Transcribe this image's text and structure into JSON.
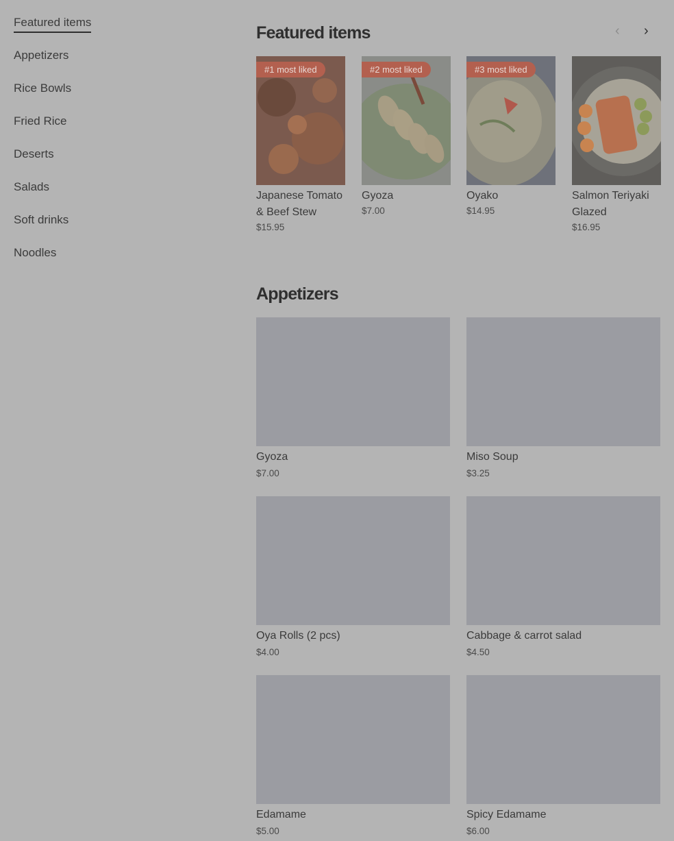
{
  "sidebar": {
    "items": [
      {
        "label": "Featured items",
        "active": true
      },
      {
        "label": "Appetizers"
      },
      {
        "label": "Rice Bowls"
      },
      {
        "label": "Fried Rice"
      },
      {
        "label": "Deserts"
      },
      {
        "label": "Salads"
      },
      {
        "label": "Soft drinks"
      },
      {
        "label": "Noodles"
      }
    ]
  },
  "featured": {
    "title": "Featured items",
    "prev_icon": "chevron-left-icon",
    "next_icon": "chevron-right-icon",
    "items": [
      {
        "badge": "#1 most liked",
        "name": "Japanese Tomato & Beef Stew",
        "price": "$15.95"
      },
      {
        "badge": "#2 most liked",
        "name": "Gyoza",
        "price": "$7.00"
      },
      {
        "badge": "#3 most liked",
        "name": "Oyako",
        "price": "$14.95"
      },
      {
        "badge": "",
        "name": "Salmon Teriyaki Glazed",
        "price": "$16.95"
      }
    ]
  },
  "appetizers": {
    "title": "Appetizers",
    "items": [
      {
        "name": "Gyoza",
        "price": "$7.00"
      },
      {
        "name": "Miso Soup",
        "price": "$3.25"
      },
      {
        "name": "Oya Rolls (2 pcs)",
        "price": "$4.00"
      },
      {
        "name": "Cabbage & carrot salad",
        "price": "$4.50"
      },
      {
        "name": "Edamame",
        "price": "$5.00"
      },
      {
        "name": "Spicy Edamame",
        "price": "$6.00"
      }
    ]
  },
  "colors": {
    "overlay_bg": "#b4b4b4",
    "badge": "#b3604f",
    "placeholder": "#9b9ca2"
  }
}
